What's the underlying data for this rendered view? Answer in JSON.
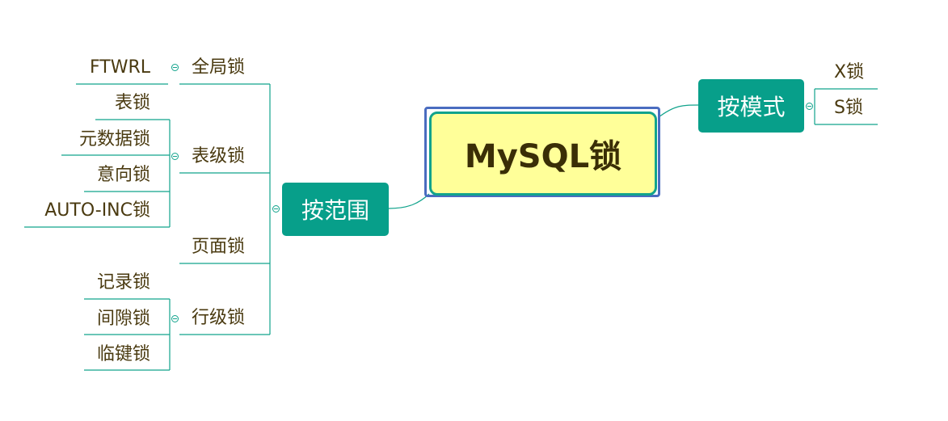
{
  "root": "MySQL锁",
  "branches": {
    "by_mode": "按模式",
    "by_scope": "按范围"
  },
  "mode_items": [
    "X锁",
    "S锁"
  ],
  "scope": {
    "global": {
      "label": "全局锁",
      "children": [
        "FTWRL"
      ]
    },
    "table": {
      "label": "表级锁",
      "children": [
        "表锁",
        "元数据锁",
        "意向锁",
        "AUTO-INC锁"
      ]
    },
    "page": {
      "label": "页面锁",
      "children": []
    },
    "row": {
      "label": "行级锁",
      "children": [
        "记录锁",
        "间隙锁",
        "临键锁"
      ]
    }
  },
  "colors": {
    "branch_fill": "#079f8a",
    "line": "#11a38c",
    "root_fill": "#ffff99",
    "root_border": "#11a38c",
    "root_outline": "#4a6cc0",
    "text": "#4a3a10"
  }
}
